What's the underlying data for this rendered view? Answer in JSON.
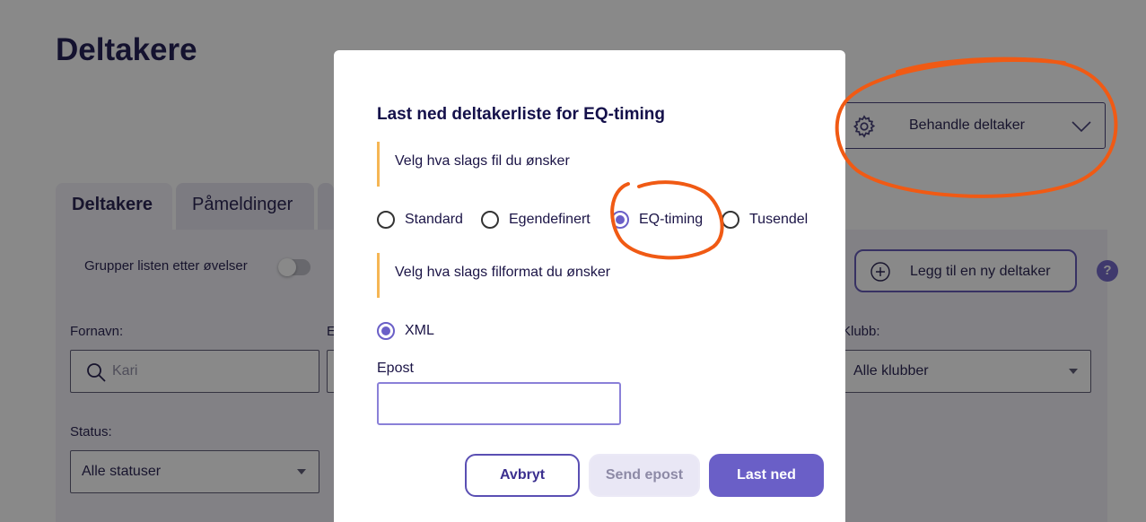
{
  "page": {
    "title": "Deltakere",
    "manage_button": "Behandle deltaker",
    "tabs": [
      {
        "label": "Deltakere",
        "active": true
      },
      {
        "label": "Påmeldinger",
        "active": false
      }
    ],
    "group_toggle_label": "Grupper listen etter øvelser",
    "group_toggle_on": false,
    "add_participant_button": "Legg til en ny deltaker",
    "help_label": "?",
    "filters": {
      "first_name_label": "Fornavn:",
      "first_name_placeholder": "Kari",
      "second_label_partial": "E",
      "club_label": "Klubb:",
      "club_value": "Alle klubber",
      "status_label": "Status:",
      "status_value": "Alle statuser"
    }
  },
  "modal": {
    "title": "Last ned deltakerliste for EQ-timing",
    "file_type_hint": "Velg hva slags fil du ønsker",
    "file_types": [
      {
        "label": "Standard",
        "checked": false
      },
      {
        "label": "Egendefinert",
        "checked": false
      },
      {
        "label": "EQ-timing",
        "checked": true
      },
      {
        "label": "Tusendel",
        "checked": false
      }
    ],
    "file_format_hint": "Velg hva slags filformat du ønsker",
    "file_formats": [
      {
        "label": "XML",
        "checked": true
      }
    ],
    "email_label": "Epost",
    "email_value": "",
    "buttons": {
      "cancel": "Avbryt",
      "send_email": "Send epost",
      "download": "Last ned"
    }
  },
  "colors": {
    "accent": "#6a5fc7",
    "hint_border": "#f5b654",
    "annotation": "#f05a14",
    "overlay": "rgba(20,20,20,0.5)"
  }
}
